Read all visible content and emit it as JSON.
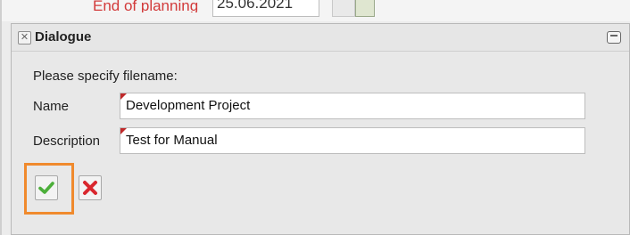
{
  "background": {
    "label": "End of planning",
    "date": "25.06.2021"
  },
  "dialog": {
    "title": "Dialogue",
    "prompt": "Please specify filename:",
    "fields": [
      {
        "label": "Name",
        "value": "Development Project"
      },
      {
        "label": "Description",
        "value": "Test for Manual"
      }
    ],
    "ok_icon": "check-icon",
    "cancel_icon": "cross-icon",
    "colors": {
      "required_marker": "#c0292a",
      "highlight": "#f08a2d",
      "ok_green": "#4caf3a",
      "cancel_red": "#d9272e"
    }
  }
}
